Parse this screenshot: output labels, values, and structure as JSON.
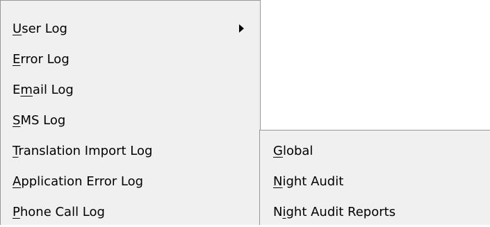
{
  "main_menu": {
    "items": [
      {
        "pre": "",
        "acc": "U",
        "post": "ser Log",
        "has_submenu": true
      },
      {
        "pre": "",
        "acc": "E",
        "post": "rror Log",
        "has_submenu": false
      },
      {
        "pre": "E",
        "acc": "m",
        "post": "ail Log",
        "has_submenu": false
      },
      {
        "pre": "",
        "acc": "S",
        "post": "MS Log",
        "has_submenu": false
      },
      {
        "pre": "",
        "acc": "T",
        "post": "ranslation Import Log",
        "has_submenu": false
      },
      {
        "pre": "",
        "acc": "A",
        "post": "pplication Error Log",
        "has_submenu": false
      },
      {
        "pre": "",
        "acc": "P",
        "post": "hone Call Log",
        "has_submenu": false
      }
    ]
  },
  "sub_menu": {
    "items": [
      {
        "pre": "",
        "acc": "G",
        "post": "lobal"
      },
      {
        "pre": "",
        "acc": "N",
        "post": "ight Audit"
      },
      {
        "pre": "N",
        "acc": "i",
        "post": "ght Audit Reports"
      }
    ]
  },
  "icons": {
    "submenu_arrow": "triangle-right-icon"
  },
  "colors": {
    "menu_bg": "#f0f0f0",
    "menu_border": "#979797",
    "text": "#000000"
  }
}
